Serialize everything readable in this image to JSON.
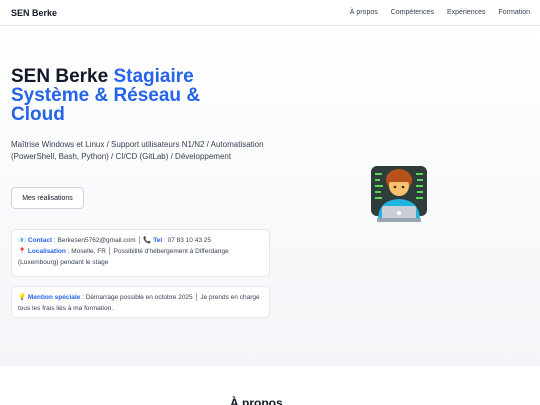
{
  "navbar": {
    "brand": "SEN Berke",
    "links": [
      "À propos",
      "Compétences",
      "Expériences",
      "Formation"
    ]
  },
  "hero": {
    "title_name": "SEN Berke",
    "title_accent": "Stagiaire Système & Réseau & Cloud",
    "subtitle": "Maîtrise Windows et Linux / Support utilisateurs N1/N2 / Automatisation (PowerShell, Bash, Python) / CI/CD (GitLab) / Développement",
    "button_label": "Mes réalisations",
    "avatar_icon": "technologist-emoji"
  },
  "contact_card": {
    "contact_icon": "📧",
    "contact_label": "Contact",
    "contact_value": ": Berkesen5762@gmail.com │",
    "tel_icon": "📞",
    "tel_label": "Tel",
    "tel_value": ": 07 83 10 43 25",
    "loc_icon": "📍",
    "loc_label": "Localisation",
    "loc_value": ": Moselle, FR │ Possibilité d'hébergement à Differdange (Luxembourg) pendant le stage"
  },
  "mention_card": {
    "icon": "💡",
    "label": "Mention spéciale",
    "value": ": Démarrage possible en octobre 2025 │ Je prends en charge tous les frais liés à ma formation."
  },
  "about": {
    "heading": "À propos"
  }
}
